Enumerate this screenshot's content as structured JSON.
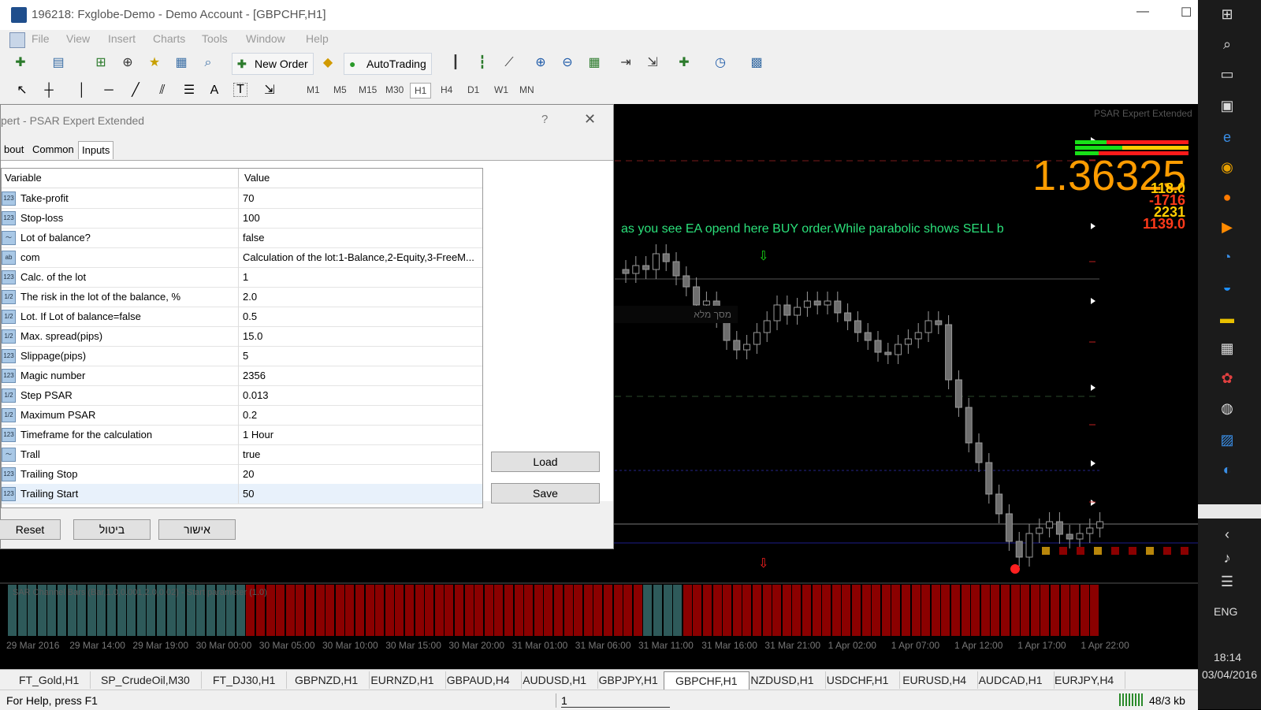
{
  "window": {
    "title": "196218: Fxglobe-Demo - Demo Account - [GBPCHF,H1]",
    "minimize": "—",
    "maximize": "☐"
  },
  "menu": [
    "File",
    "View",
    "Insert",
    "Charts",
    "Tools",
    "Window",
    "Help"
  ],
  "toolbar": {
    "new_order": "New Order",
    "autotrading": "AutoTrading",
    "text_tool": "A",
    "text_label_tool": "T",
    "timeframes": [
      "M1",
      "M5",
      "M15",
      "M30",
      "H1",
      "H4",
      "D1",
      "W1",
      "MN"
    ],
    "active_timeframe": "H1"
  },
  "chart": {
    "ea_label": "PSAR Expert Extended",
    "price": "1.36325",
    "stats": [
      "118.0",
      "-1716",
      "2231",
      "1139.0"
    ],
    "stat_colors": [
      "#ffcc00",
      "#ff3a1a",
      "#ffcc00",
      "#ff3a1a"
    ],
    "annotation": "as you see EA opend here BUY order.While parabolic shows SELL b",
    "hebrew_overlay": "מסך מלא",
    "indicator_label": "SAR Channel Bars (Bar,1.0,0.001,2.0,0.02) - Start parameter (1.0)",
    "time_labels": [
      "29 Mar 2016",
      "29 Mar 14:00",
      "29 Mar 19:00",
      "30 Mar 00:00",
      "30 Mar 05:00",
      "30 Mar 10:00",
      "30 Mar 15:00",
      "30 Mar 20:00",
      "31 Mar 01:00",
      "31 Mar 06:00",
      "31 Mar 11:00",
      "31 Mar 16:00",
      "31 Mar 21:00",
      "1 Apr 02:00",
      "1 Apr 07:00",
      "1 Apr 12:00",
      "1 Apr 17:00",
      "1 Apr 22:00"
    ],
    "colors": {
      "bull_candle": "#000000",
      "bear_candle": "#6e6e6e",
      "candle_outline": "#9a9a9a",
      "annotation": "#2be07a",
      "price": "#ff9c00",
      "indicator_red": "#8b0000",
      "indicator_teal": "#2e5a5a"
    }
  },
  "dialog": {
    "title": "pert - PSAR Expert Extended",
    "help": "?",
    "close": "✕",
    "tabs": [
      "bout",
      "Common",
      "Inputs"
    ],
    "active_tab": "Inputs",
    "columns": [
      "Variable",
      "Value"
    ],
    "rows": [
      {
        "type": "123",
        "variable": "Take-profit",
        "value": "70"
      },
      {
        "type": "123",
        "variable": "Stop-loss",
        "value": "100"
      },
      {
        "type": "bool",
        "variable": "Lot of balance?",
        "value": "false"
      },
      {
        "type": "ab",
        "variable": "com",
        "value": "Calculation of the lot:1-Balance,2-Equity,3-FreeM..."
      },
      {
        "type": "123",
        "variable": "Calc. of the lot",
        "value": "1"
      },
      {
        "type": "1/2",
        "variable": "The risk in the lot of the balance, %",
        "value": "2.0"
      },
      {
        "type": "1/2",
        "variable": "Lot. If Lot of balance=false",
        "value": "0.5"
      },
      {
        "type": "1/2",
        "variable": "Max. spread(pips)",
        "value": "15.0"
      },
      {
        "type": "123",
        "variable": "Slippage(pips)",
        "value": "5"
      },
      {
        "type": "123",
        "variable": "Magic number",
        "value": "2356"
      },
      {
        "type": "1/2",
        "variable": "Step PSAR",
        "value": "0.013"
      },
      {
        "type": "1/2",
        "variable": "Maximum PSAR",
        "value": "0.2"
      },
      {
        "type": "123",
        "variable": "Timeframe for the calculation",
        "value": "1 Hour"
      },
      {
        "type": "bool",
        "variable": "Trall",
        "value": "true"
      },
      {
        "type": "123",
        "variable": "Trailing Stop",
        "value": "20"
      },
      {
        "type": "123",
        "variable": "Trailing Start",
        "value": "50"
      }
    ],
    "load": "Load",
    "save": "Save",
    "reset": "Reset",
    "cancel": "ביטול",
    "ok": "אישור"
  },
  "symbol_tabs": [
    "FT_Gold,H1",
    "SP_CrudeOil,M30",
    "FT_DJ30,H1",
    "GBPNZD,H1",
    "EURNZD,H1",
    "GBPAUD,H4",
    "AUDUSD,H1",
    "GBPJPY,H1",
    "GBPCHF,H1",
    "NZDUSD,H1",
    "USDCHF,H1",
    "EURUSD,H4",
    "AUDCAD,H1",
    "EURJPY,H4"
  ],
  "active_symbol": "GBPCHF,H1",
  "status": {
    "help": "For Help, press F1",
    "field": "1",
    "traffic": "48/3 kb"
  },
  "taskbar": {
    "time": "18:14",
    "date": "03/04/2016",
    "lang": "ENG"
  }
}
